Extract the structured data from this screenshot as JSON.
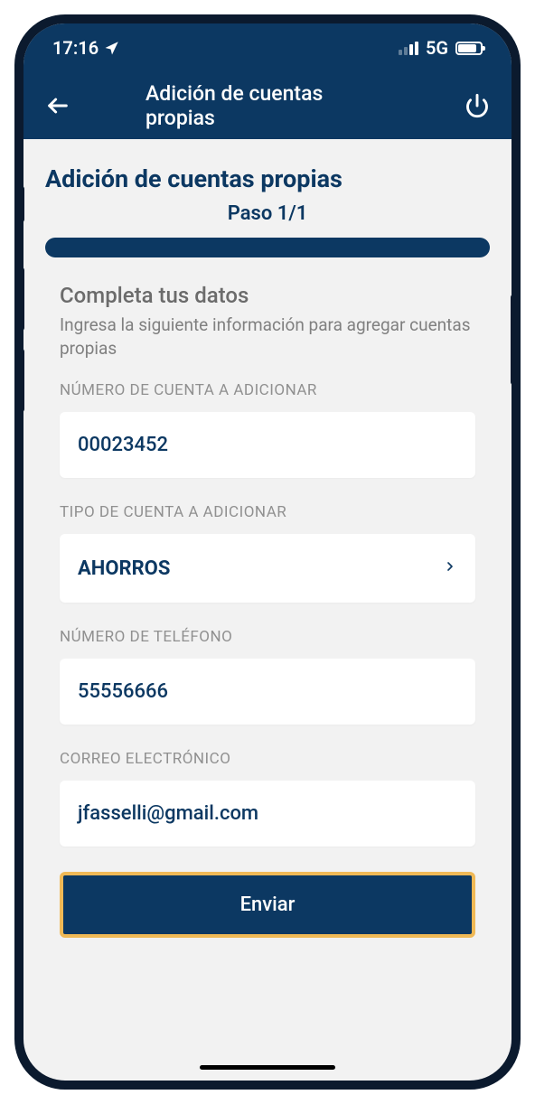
{
  "status_bar": {
    "time": "17:16",
    "network": "5G"
  },
  "nav": {
    "title": "Adición de cuentas propias"
  },
  "page": {
    "title": "Adición de cuentas propias",
    "step": "Paso 1/1",
    "section_title": "Completa tus datos",
    "section_desc": "Ingresa la siguiente información para agregar cuentas propias"
  },
  "fields": {
    "account_number": {
      "label": "NÚMERO DE CUENTA A ADICIONAR",
      "value": "00023452"
    },
    "account_type": {
      "label": "TIPO DE CUENTA A ADICIONAR",
      "value": "AHORROS"
    },
    "phone": {
      "label": "NÚMERO DE TELÉFONO",
      "value": "55556666"
    },
    "email": {
      "label": "CORREO ELECTRÓNICO",
      "value": "jfasselli@gmail.com"
    }
  },
  "submit": {
    "label": "Enviar"
  }
}
